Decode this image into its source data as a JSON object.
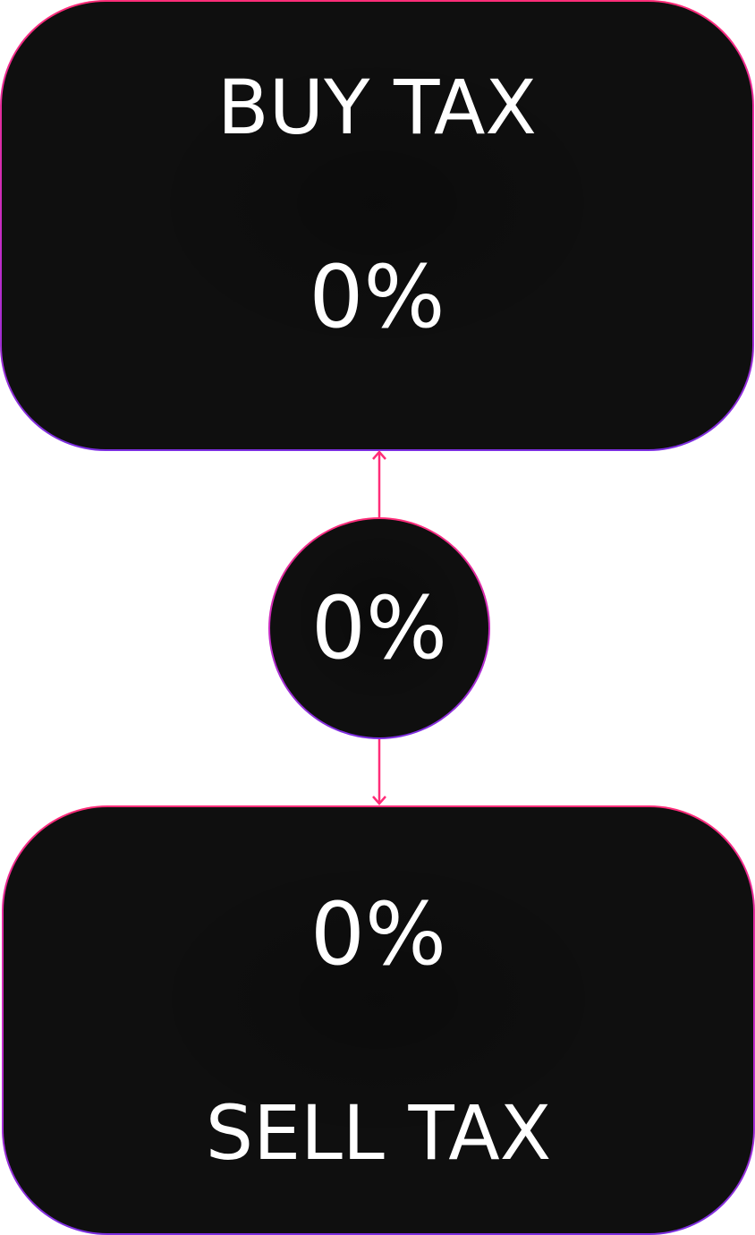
{
  "buy_tax": {
    "title": "BUY TAX",
    "value": "0%"
  },
  "center": {
    "value": "0%"
  },
  "sell_tax": {
    "title": "SELL TAX",
    "value": "0%"
  },
  "colors": {
    "card_background": "#0f0f0f",
    "text": "#ffffff",
    "border_top": "#ff2d78",
    "border_bottom": "#7b2fe0",
    "connector": "#ff2d78"
  }
}
